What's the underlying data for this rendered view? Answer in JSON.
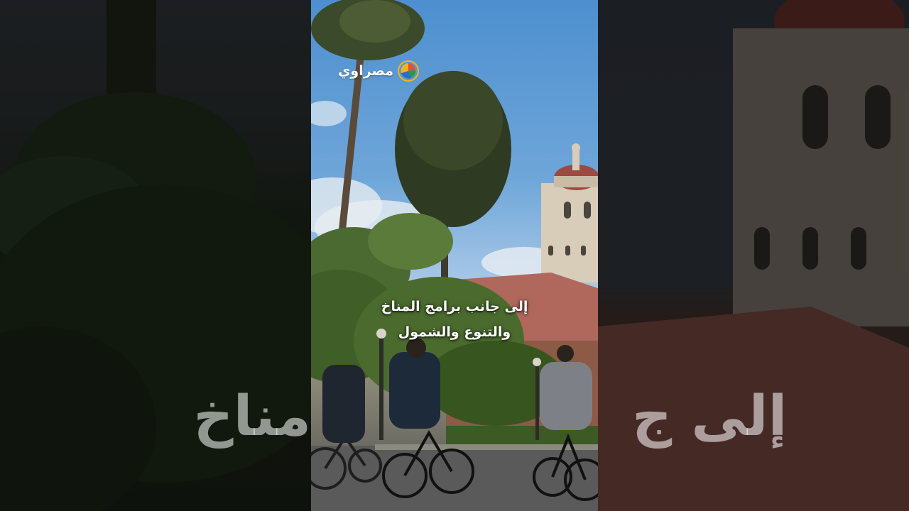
{
  "logo": {
    "text": "مصراوي",
    "icon": "masrawy-logo-icon",
    "colors": [
      "#e84c3d",
      "#2a9a4a",
      "#2d6ec4",
      "#f3b31b"
    ]
  },
  "caption": {
    "line1": "إلى جانب برامج المناخ",
    "line2": "والتنوع والشمول"
  },
  "background_ghost": {
    "left_text": "مناخ",
    "right_text": "إلى ج"
  }
}
